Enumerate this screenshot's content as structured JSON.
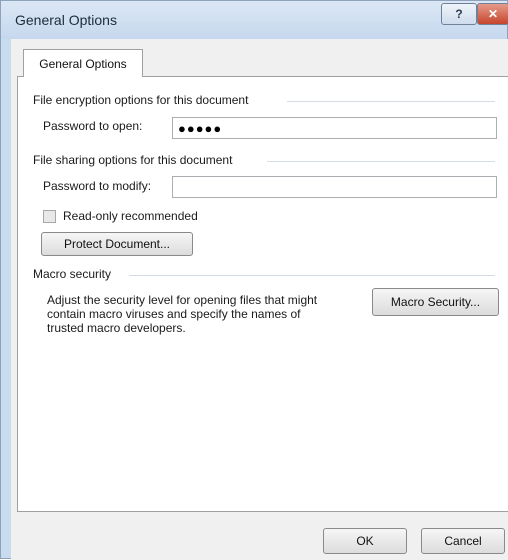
{
  "window": {
    "title": "General Options",
    "help_symbol": "?",
    "close_symbol": "✕"
  },
  "tab": {
    "label": "General Options"
  },
  "encryption": {
    "group_label": "File encryption options for this document",
    "password_label": "Password to open:",
    "password_value": "●●●●●"
  },
  "sharing": {
    "group_label": "File sharing options for this document",
    "password_label": "Password to modify:",
    "password_value": "",
    "readonly_label": "Read-only recommended",
    "readonly_checked": false,
    "protect_button": "Protect Document..."
  },
  "macro": {
    "group_label": "Macro security",
    "description_lines": [
      "Adjust the security level for opening files that might",
      "contain macro viruses and specify the names of",
      "trusted macro developers."
    ],
    "button": "Macro Security..."
  },
  "footer": {
    "ok": "OK",
    "cancel": "Cancel"
  }
}
